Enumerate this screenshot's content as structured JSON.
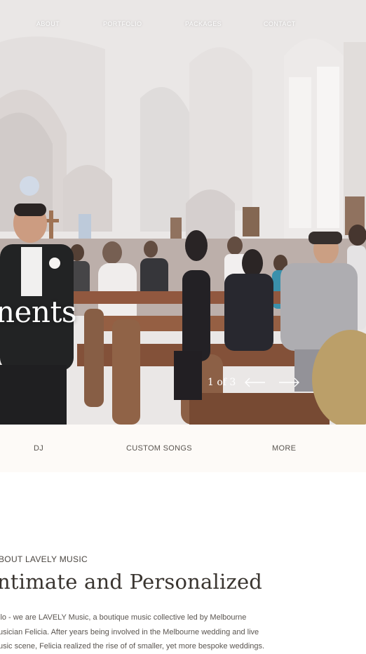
{
  "nav": {
    "items": [
      {
        "label": "ABOUT"
      },
      {
        "label": "PORTFOLIO"
      },
      {
        "label": "PACKAGES"
      },
      {
        "label": "CONTACT"
      }
    ]
  },
  "hero": {
    "title": "nents",
    "slider_counter": "1 of 3",
    "prev_icon": "arrow-left-icon",
    "next_icon": "arrow-right-icon"
  },
  "menu": {
    "items": [
      {
        "label": "DJ"
      },
      {
        "label": "CUSTOM SONGS"
      },
      {
        "label": "MORE"
      }
    ]
  },
  "about": {
    "kicker": "BOUT LAVELY MUSIC",
    "heading": "ntimate and Personalized",
    "body": [
      "llo - we are LAVELY Music, a boutique music collective led by Melbourne",
      "usician Felicia. After years being involved in the Melbourne wedding and live",
      "usic scene, Felicia realized the rise of of smaller, yet more bespoke weddings."
    ]
  },
  "colors": {
    "menu_bg": "#fdfaf7",
    "text_dark": "#3a3530",
    "text_muted": "#5a5550",
    "pew_wood": "#7a4a2e"
  }
}
